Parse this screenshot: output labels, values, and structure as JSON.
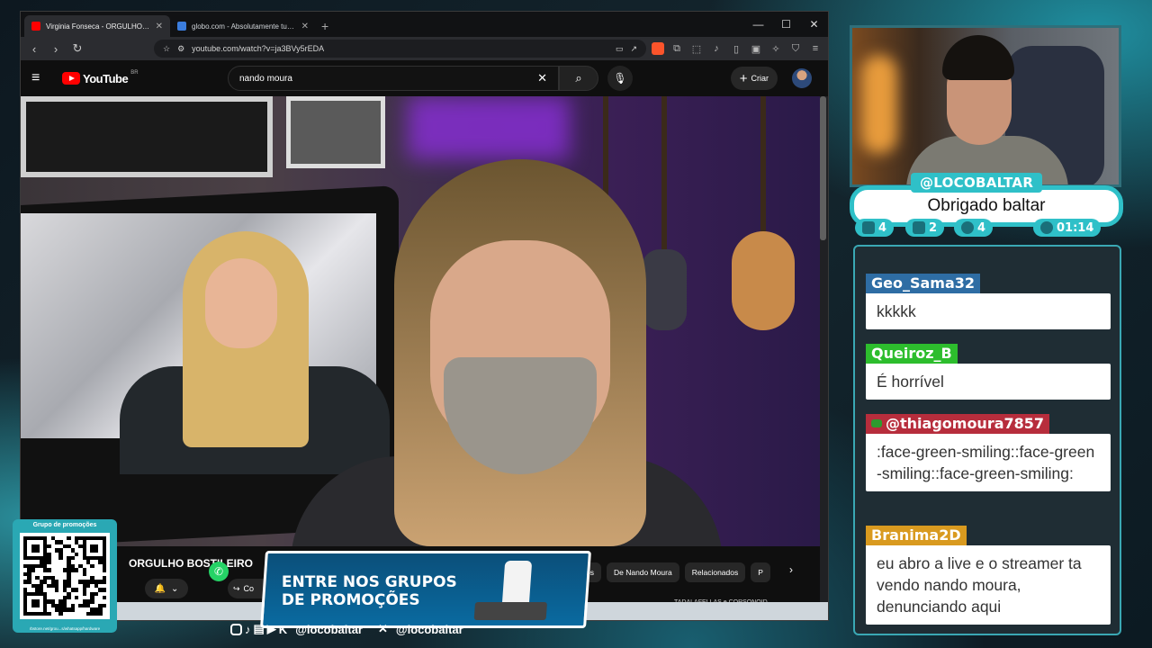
{
  "browser": {
    "tabs": [
      {
        "title": "Virginia Fonseca - ORGULHO BOSTILEIRO",
        "active": true,
        "fav_color": "#ff0000"
      },
      {
        "title": "globo.com - Absolutamente tudo sobre notícias",
        "active": false,
        "fav_color": "#3b7ddd"
      }
    ],
    "url": "youtube.com/watch?v=ja3BVy5rEDA"
  },
  "youtube": {
    "logo": "YouTube",
    "region": "BR",
    "search_value": "nando moura",
    "create_label": "Criar",
    "video_title": "ORGULHO BOSTILEIRO",
    "share_label": "Co",
    "chips": [
      "os",
      "De Nando Moura",
      "Relacionados",
      "P"
    ],
    "related_title": "TADALAFELLAS e CORSONOID..."
  },
  "stream": {
    "name_tag": "@LOCOBALTAR",
    "message": "Obrigado baltar",
    "stats": [
      {
        "icon": "twitch-icon",
        "value": "4"
      },
      {
        "icon": "youtube-icon",
        "value": "2"
      },
      {
        "icon": "kick-icon",
        "value": "4"
      },
      {
        "icon": "whatsapp-icon",
        "value": "01:14"
      }
    ]
  },
  "chat": [
    {
      "user": "Geo_Sama32",
      "color": "#2e6da4",
      "text": "kkkkk"
    },
    {
      "user": "Queiroz_B",
      "color": "#2dbd2d",
      "text": "É horrível"
    },
    {
      "user": "@thiagomoura7857",
      "color": "#b72d3c",
      "text": ":face-green-smiling::face-green-smiling::face-green-smiling:",
      "yt": true
    },
    {
      "user": "Branima2D",
      "color": "#d99a1f",
      "text": "eu abro a live e o streamer ta vendo nando moura, denunciando aqui"
    }
  ],
  "promo": {
    "qr_header": "Grupo de promoções",
    "qr_footer": "rbstore.net/grou...s/whatsapp/hardware",
    "banner_line1": "ENTRE NOS GRUPOS",
    "banner_line2": "DE PROMOÇÕES"
  },
  "socials": {
    "handle1": "@locobaltar",
    "handle2": "@locobaltar"
  }
}
